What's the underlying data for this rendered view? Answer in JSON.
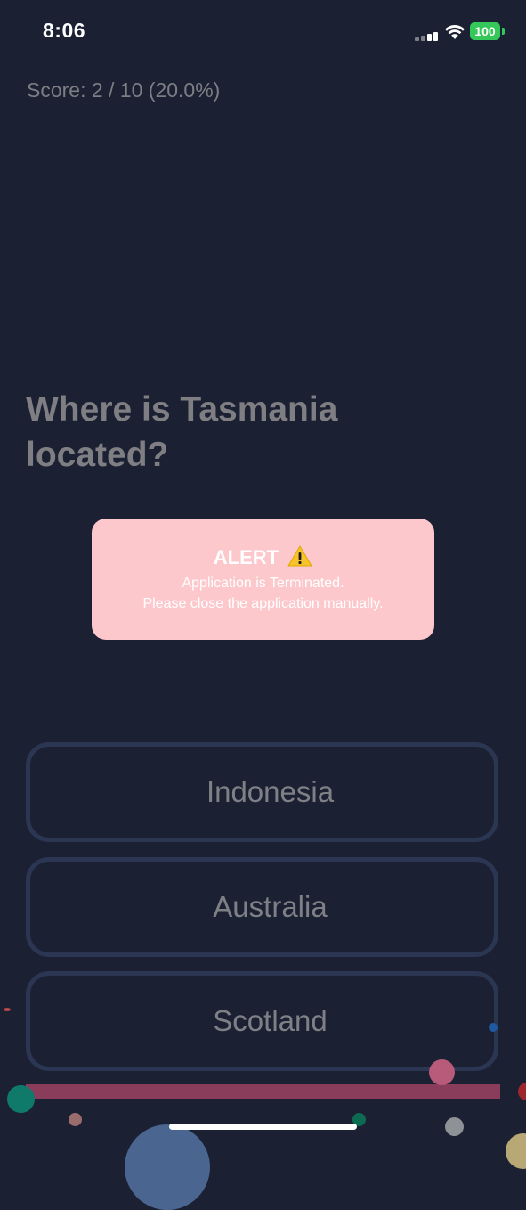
{
  "status_bar": {
    "time": "8:06",
    "battery": "100",
    "icons": [
      "signal-icon",
      "wifi-icon",
      "battery-icon"
    ]
  },
  "quiz": {
    "score": "Score: 2 / 10 (20.0%)",
    "question": "Where is Tasmania located?",
    "progress": 0.2,
    "options": [
      {
        "label": "Indonesia"
      },
      {
        "label": "Australia"
      },
      {
        "label": "Scotland"
      }
    ]
  },
  "alert": {
    "title": "ALERT",
    "icon": "warning-icon",
    "line1": "Application is Terminated.",
    "line2": "Please close the application manually."
  },
  "colors": {
    "background": "#1b2033",
    "alert_background": "#fdc8cc",
    "option_border": "#2b3652",
    "progress": "#8a3d5a",
    "battery": "#34c759"
  }
}
